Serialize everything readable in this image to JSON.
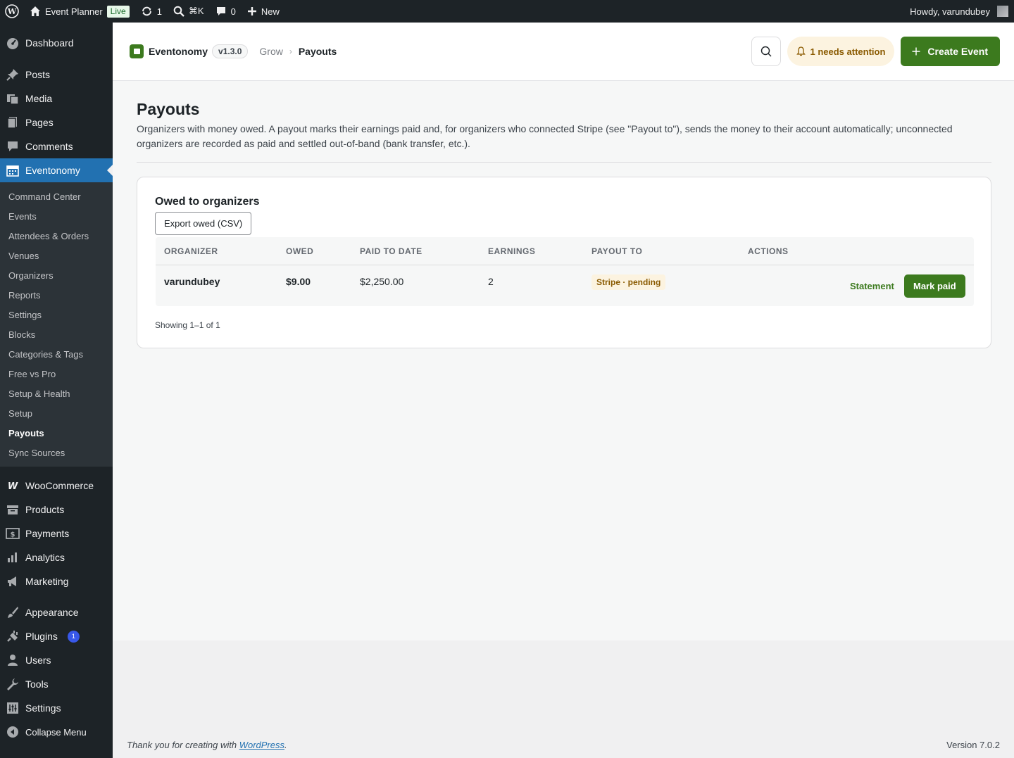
{
  "adminbar": {
    "site_name": "Event Planner",
    "live_label": "Live",
    "updates_count": "1",
    "search_shortcut": "⌘K",
    "comments_count": "0",
    "new_label": "New",
    "howdy": "Howdy, varundubey"
  },
  "sidebar": {
    "items_top": [
      {
        "label": "Dashboard",
        "icon": "dashboard-icon"
      }
    ],
    "items_content": [
      {
        "label": "Posts",
        "icon": "pin-icon"
      },
      {
        "label": "Media",
        "icon": "media-icon"
      },
      {
        "label": "Pages",
        "icon": "pages-icon"
      },
      {
        "label": "Comments",
        "icon": "comment-icon"
      },
      {
        "label": "Eventonomy",
        "icon": "calendar-icon"
      }
    ],
    "submenu": [
      "Command Center",
      "Events",
      "Attendees & Orders",
      "Venues",
      "Organizers",
      "Reports",
      "Settings",
      "Blocks",
      "Categories & Tags",
      "Free vs Pro",
      "Setup & Health",
      "Setup",
      "Payouts",
      "Sync Sources"
    ],
    "items_commerce": [
      {
        "label": "WooCommerce",
        "icon": "woo-icon"
      },
      {
        "label": "Products",
        "icon": "archive-icon"
      },
      {
        "label": "Payments",
        "icon": "dollar-icon"
      },
      {
        "label": "Analytics",
        "icon": "bar-chart-icon"
      },
      {
        "label": "Marketing",
        "icon": "megaphone-icon"
      }
    ],
    "items_admin": [
      {
        "label": "Appearance",
        "icon": "brush-icon"
      },
      {
        "label": "Plugins",
        "icon": "plug-icon",
        "badge": "1"
      },
      {
        "label": "Users",
        "icon": "user-icon"
      },
      {
        "label": "Tools",
        "icon": "wrench-icon"
      },
      {
        "label": "Settings",
        "icon": "settings-icon"
      },
      {
        "label": "Collapse Menu",
        "icon": "collapse-icon"
      }
    ]
  },
  "header": {
    "brand": "Eventonomy",
    "version": "v1.3.0",
    "crumb_parent": "Grow",
    "crumb_current": "Payouts",
    "attention": "1 needs attention",
    "create_label": "Create Event"
  },
  "page": {
    "title": "Payouts",
    "description": "Organizers with money owed. A payout marks their earnings paid and, for organizers who connected Stripe (see \"Payout to\"), sends the money to their account automatically; unconnected organizers are recorded as paid and settled out-of-band (bank transfer, etc.)."
  },
  "card": {
    "title": "Owed to organizers",
    "export_label": "Export owed (CSV)",
    "columns": [
      "ORGANIZER",
      "OWED",
      "PAID TO DATE",
      "EARNINGS",
      "PAYOUT TO",
      "ACTIONS"
    ],
    "rows": [
      {
        "organizer": "varundubey",
        "owed": "$9.00",
        "paid_to_date": "$2,250.00",
        "earnings": "2",
        "payout_to": "Stripe · pending",
        "statement_label": "Statement",
        "mark_paid_label": "Mark paid"
      }
    ],
    "showing": "Showing 1–1 of 1"
  },
  "footer": {
    "thanks_prefix": "Thank you for creating with ",
    "thanks_link": "WordPress",
    "thanks_suffix": ".",
    "version": "Version 7.0.2"
  },
  "colors": {
    "brand_green": "#3c7a1e",
    "wp_blue": "#2271b1",
    "admin_dark": "#1d2327",
    "warning_bg": "#fcf3e0"
  }
}
